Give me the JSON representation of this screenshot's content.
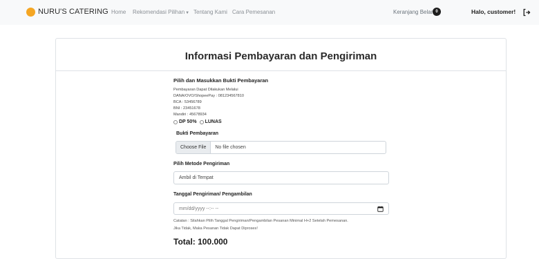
{
  "navbar": {
    "brand": "NURU'S CATERING",
    "links": [
      "Home",
      "Rekomendasi Pilihan",
      "Tentang Kami",
      "Cara Pemesanan"
    ],
    "cart_label": "Keranjang Belanja",
    "cart_count": "0",
    "greeting": "Halo, customer!",
    "brand_color": "#f5a623"
  },
  "card": {
    "title": "Informasi Pembayaran dan Pengiriman",
    "payment": {
      "heading": "Pilih dan Masukkan Bukti Pembayaran",
      "lines": [
        "Pembayaran Dapat Dilakukan Melalui",
        "DANA/OVO/ShopeePay : 081234567810",
        "BCA : 53456789",
        "BNI : 23451678",
        "Mandiri : 45678934"
      ],
      "options": [
        "DP 50%",
        "LUNAS"
      ]
    },
    "proof": {
      "label": "Bukti Pembayaran",
      "button": "Choose File",
      "status": "No file chosen"
    },
    "shipping": {
      "label": "Pilih Metode Pengiriman",
      "value": "Ambil di Tempat"
    },
    "date": {
      "label": "Tanggal Pengiriman/ Pengambilan",
      "placeholder": "mm/dd/yyyy --:-- --"
    },
    "note_lines": [
      "Catatan : Silahkan Pilih Tanggal Pengiriman/Pengambilan Pesanan Minimal H+2 Setelah Pemesanan.",
      "Jika Tidak, Maka Pesanan Tidak Dapat Diproses!"
    ],
    "total": "Total: 100.000"
  }
}
